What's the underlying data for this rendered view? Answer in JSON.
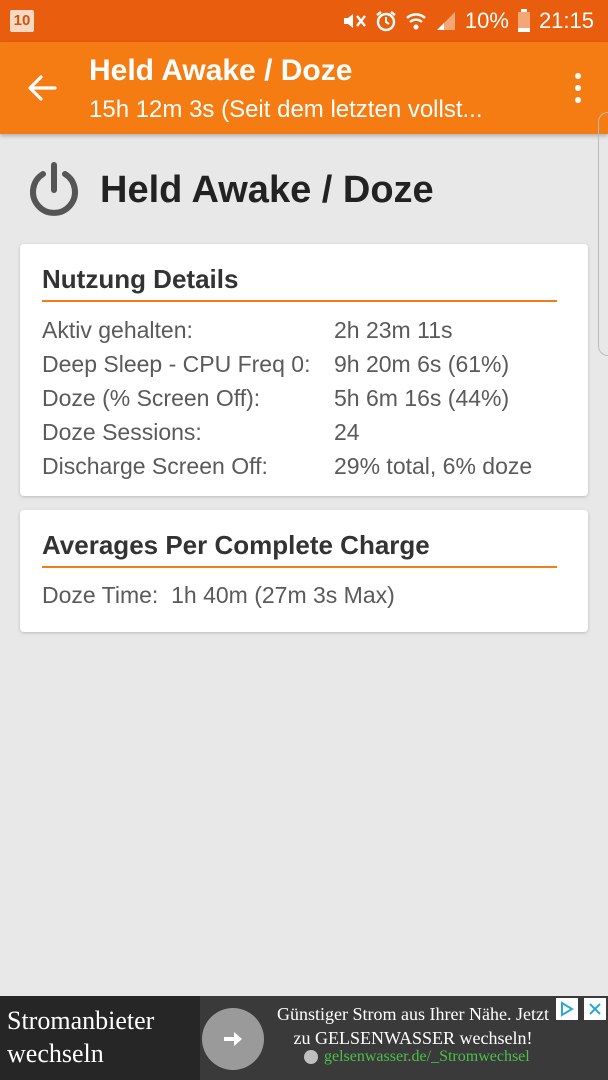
{
  "status_bar": {
    "notification_badge": "10",
    "battery_percent": "10%",
    "time": "21:15",
    "icons": [
      "mute-icon",
      "alarm-icon",
      "wifi-icon",
      "signal-icon",
      "battery-icon"
    ]
  },
  "app_bar": {
    "title": "Held Awake / Doze",
    "subtitle": "15h 12m 3s (Seit dem letzten vollst...",
    "back_icon": "arrow-back-icon",
    "menu_icon": "more-vert-icon"
  },
  "header": {
    "title": "Held Awake / Doze",
    "icon": "power-icon"
  },
  "usage_card": {
    "title": "Nutzung Details",
    "rows": [
      {
        "label": "Aktiv gehalten:",
        "value": "2h 23m 11s"
      },
      {
        "label": "Deep Sleep - CPU Freq 0:",
        "value": "9h 20m 6s (61%)"
      },
      {
        "label": "Doze (% Screen Off):",
        "value": "5h 6m 16s (44%)"
      },
      {
        "label": "Doze Sessions:",
        "value": "24"
      },
      {
        "label": "Discharge Screen Off:",
        "value": "29% total, 6% doze"
      }
    ]
  },
  "averages_card": {
    "title": "Averages Per Complete Charge",
    "line": "Doze Time:  1h 40m (27m 3s Max)"
  },
  "ad": {
    "headline": "Stromanbieter wechseln",
    "text": "Günstiger Strom aus Ihrer Nähe. Jetzt zu GELSENWASSER wechseln!",
    "url": "gelsenwasser.de/_Stromwechsel"
  },
  "colors": {
    "status_bar": "#e85e0e",
    "app_bar": "#f57c12",
    "accent_line": "#f57c12",
    "background": "#e8e8e8"
  }
}
